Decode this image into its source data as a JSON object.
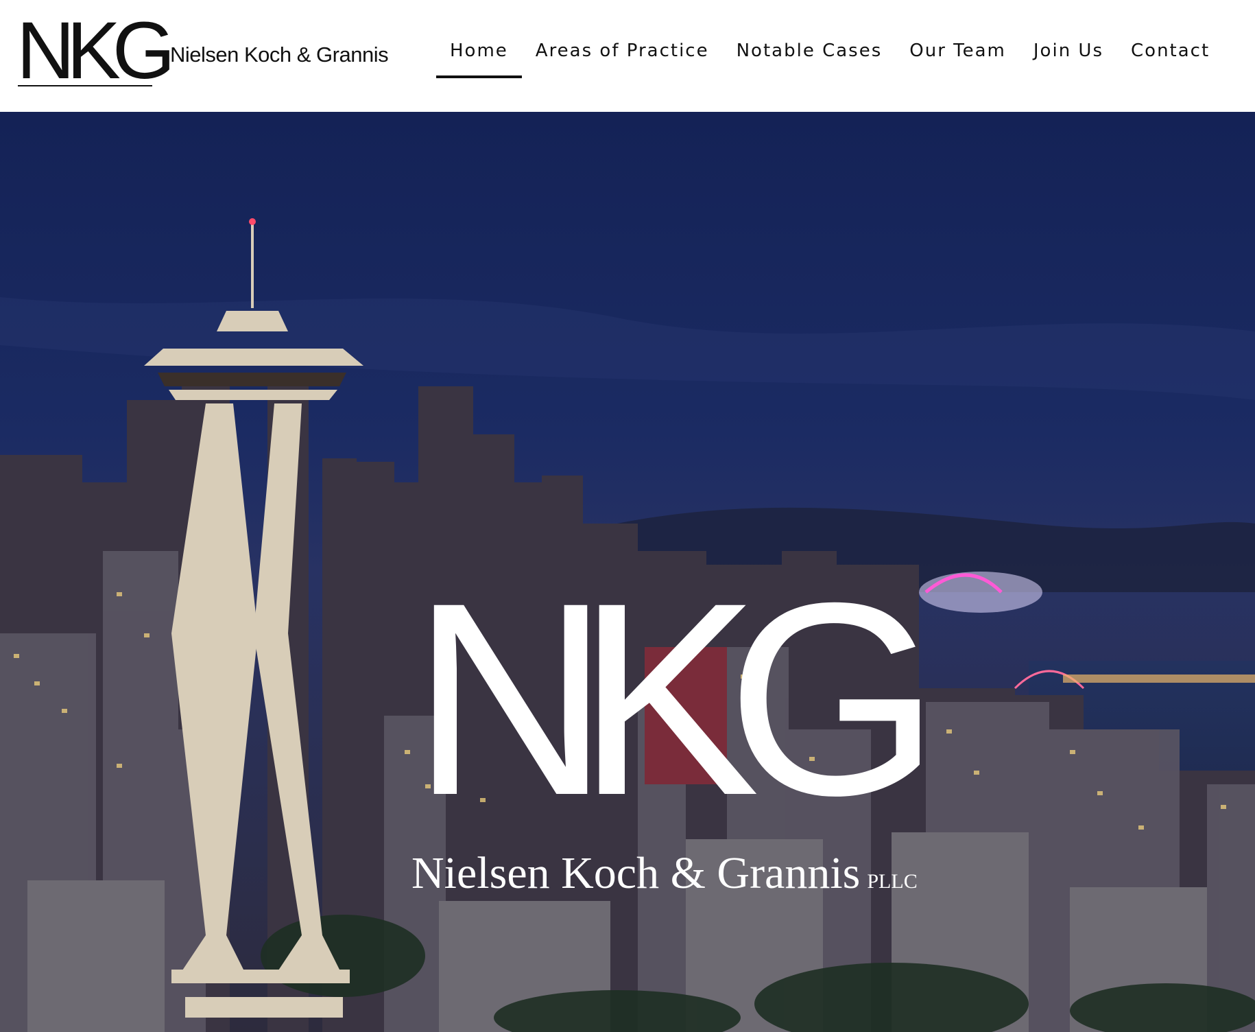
{
  "header": {
    "logo_mark": "NKG",
    "brand_name": "Nielsen Koch & Grannis"
  },
  "nav": {
    "items": [
      {
        "label": "Home"
      },
      {
        "label": "Areas of Practice"
      },
      {
        "label": "Notable Cases"
      },
      {
        "label": "Our Team"
      },
      {
        "label": "Join Us"
      },
      {
        "label": "Contact"
      }
    ]
  },
  "hero": {
    "logo_mark": "NKG",
    "firm_name": "Nielsen Koch & Grannis",
    "firm_suffix": "PLLC"
  },
  "colors": {
    "header_bg": "#ffffff",
    "text_dark": "#111111",
    "hero_sky": "#1a2a62",
    "hero_text": "#ffffff"
  }
}
